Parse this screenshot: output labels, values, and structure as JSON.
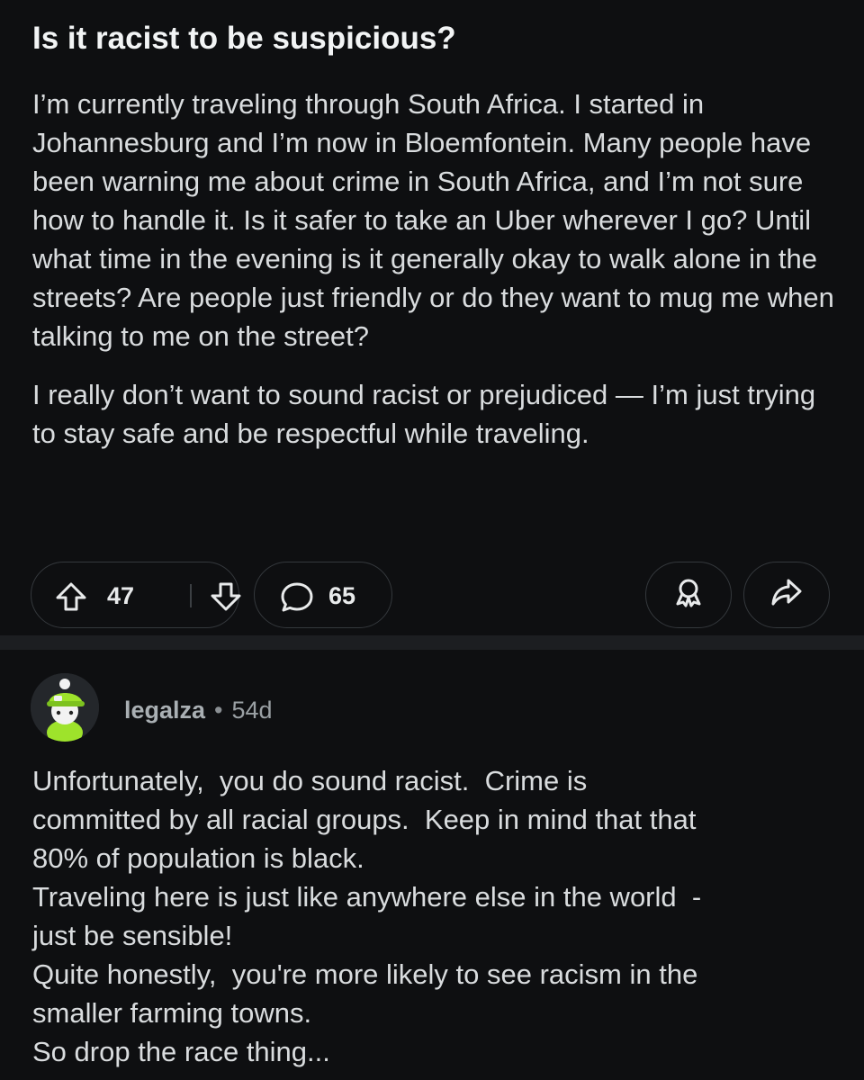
{
  "post": {
    "title": "Is it racist to be suspicious?",
    "body": [
      "I’m currently traveling through South Africa. I started in Johannesburg and I’m now in Bloemfontein. Many people have been warning me about crime in South Africa, and I’m not sure how to handle it. Is it safer to take an Uber wherever I go? Until what time in the evening is it generally okay to walk alone in the streets? Are people just friendly or do they want to mug me when talking to me on the street?",
      "I really don’t want to sound racist or prejudiced — I’m just trying to stay safe and be respectful while traveling."
    ],
    "actions": {
      "upvote_icon": "upvote-arrow-icon",
      "vote_count": "47",
      "downvote_icon": "downvote-arrow-icon",
      "comment_icon": "comment-bubble-icon",
      "comment_count": "65",
      "award_icon": "award-icon",
      "share_icon": "share-arrow-icon"
    }
  },
  "comment": {
    "avatar": "snoo-avatar-green-hat",
    "username": "legalza",
    "separator": "•",
    "age": "54d",
    "body_lines": [
      "Unfortunately,  you do sound racist.  Crime is",
      "committed by all racial groups.  Keep in mind that that",
      "80% of population is black.",
      "Traveling here is just like anywhere else in the world  -",
      "just be sensible!",
      "Quite honestly,  you're more likely to see racism in the",
      "smaller farming towns.",
      "So drop the race thing..."
    ]
  },
  "colors": {
    "background": "#0e0f11",
    "divider": "#1c1e21",
    "text": "#d9dcde",
    "muted": "#9aa0a4",
    "pill_border": "#34383c",
    "avatar_green": "#9ee32b"
  }
}
